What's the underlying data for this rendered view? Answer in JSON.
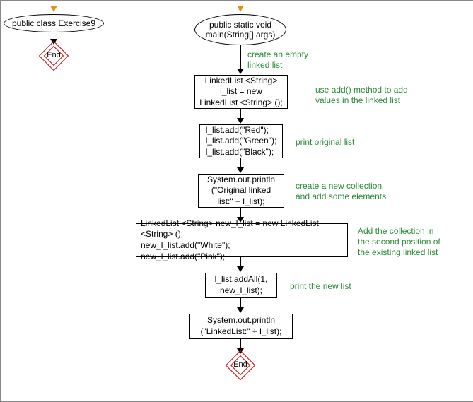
{
  "left": {
    "class_decl": "public class Exercise9",
    "end": "End"
  },
  "right": {
    "method_decl": "public static void\nmain(String[] args)",
    "comment1": "create an empty\nlinked list",
    "step1": "LinkedList <String>\nl_list = new\nLinkedList <String> ();",
    "comment2": "use add() method to add\nvalues in the linked list",
    "step2": "l_list.add(\"Red\");\nl_list.add(\"Green\");\nl_list.add(\"Black\");",
    "comment3": "print original list",
    "step3": "System.out.println\n(\"Original linked\nlist:\" + l_list);",
    "comment4": "create a new collection\nand add some elements",
    "step4": "LinkedList <String> new_l_list = new LinkedList <String> ();\nnew_l_list.add(\"White\");\nnew_l_list.add(\"Pink\");",
    "comment5": "Add the collection in\nthe second position of\nthe existing linked list",
    "step5": "l_list.addAll(1,\nnew_l_list);",
    "comment6": "print the new list",
    "step6": "System.out.println\n(\"LinkedList:\" + l_list);",
    "end": "End"
  }
}
